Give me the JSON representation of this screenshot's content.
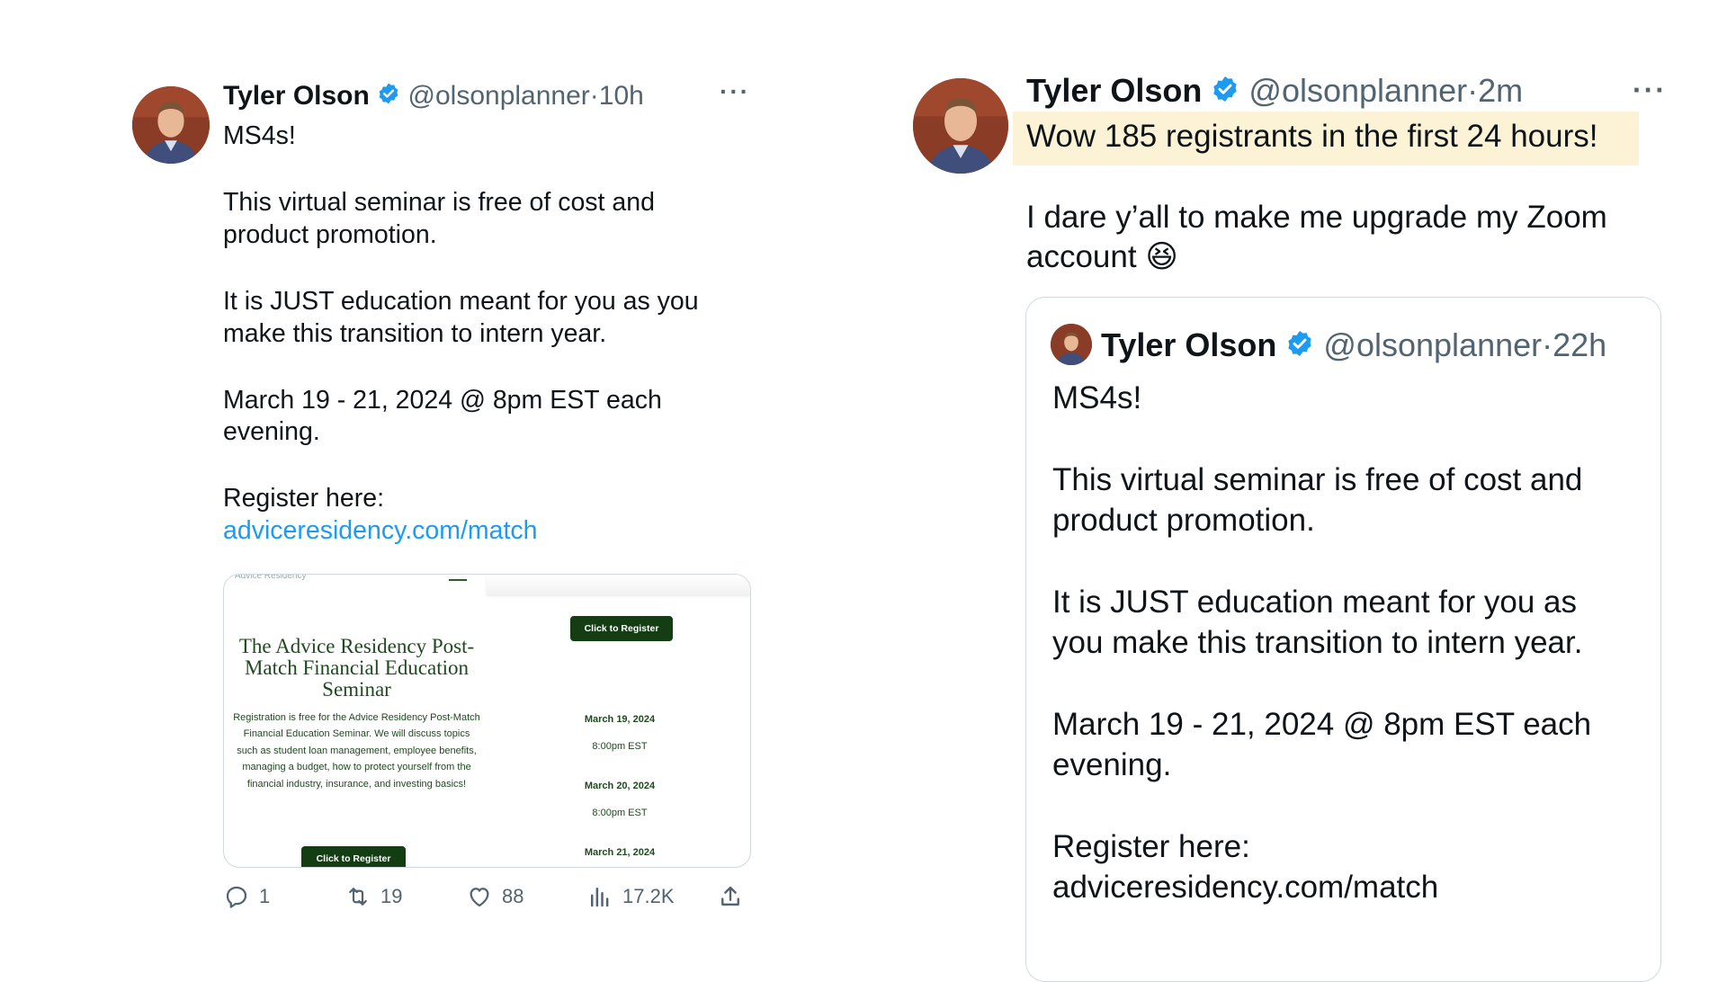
{
  "left_tweet": {
    "author_name": "Tyler Olson",
    "handle": "@olsonplanner",
    "separator": "·",
    "time": "10h",
    "more": "···",
    "paragraphs": [
      "MS4s!",
      "This virtual seminar is free of cost and product promotion.",
      "It is JUST education meant for you as you make this transition to intern year.",
      "March 19 - 21, 2024 @ 8pm EST each evening.",
      "Register here:"
    ],
    "link": "adviceresidency.com/match",
    "card": {
      "faint_header": "Advice Residency",
      "title": "The Advice Residency Post-Match Financial Education Seminar",
      "description": "Registration is free for the Advice Residency Post-Match Financial Education Seminar. We will discuss topics such as student loan management, employee benefits, managing a budget, how to protect yourself from the financial industry, insurance, and investing basics!",
      "register_button_top": "Click to Register",
      "register_button_bottom": "Click to Register",
      "dates": [
        {
          "date": "March 19, 2024",
          "time": "8:00pm EST"
        },
        {
          "date": "March 20, 2024",
          "time": "8:00pm EST"
        },
        {
          "date": "March 21, 2024",
          "time": ""
        }
      ],
      "brand_color": "#143d14"
    },
    "actions": {
      "replies": "1",
      "retweets": "19",
      "likes": "88",
      "views": "17.2K"
    }
  },
  "right_tweet": {
    "author_name": "Tyler Olson",
    "handle": "@olsonplanner",
    "separator": "·",
    "time": "2m",
    "more": "···",
    "highlight_text": "Wow 185 registrants in the first 24 hours!",
    "highlight_color": "#fcf3d6",
    "text": "I dare y’all to make me upgrade my Zoom account",
    "emoji": "😆",
    "quoted": {
      "author_name": "Tyler Olson",
      "handle": "@olsonplanner",
      "separator": "·",
      "time": "22h",
      "paragraphs": [
        "MS4s!",
        "This virtual seminar is free of cost and product promotion.",
        "It is JUST education meant for you as you make this transition to intern year.",
        "March 19 - 21, 2024 @ 8pm EST each evening.",
        "Register here:",
        "adviceresidency.com/match"
      ]
    }
  },
  "colors": {
    "text": "#0f1419",
    "secondary": "#536471",
    "link": "#1d9bf0",
    "verified": "#1d9bf0",
    "border": "#cfd9de"
  }
}
